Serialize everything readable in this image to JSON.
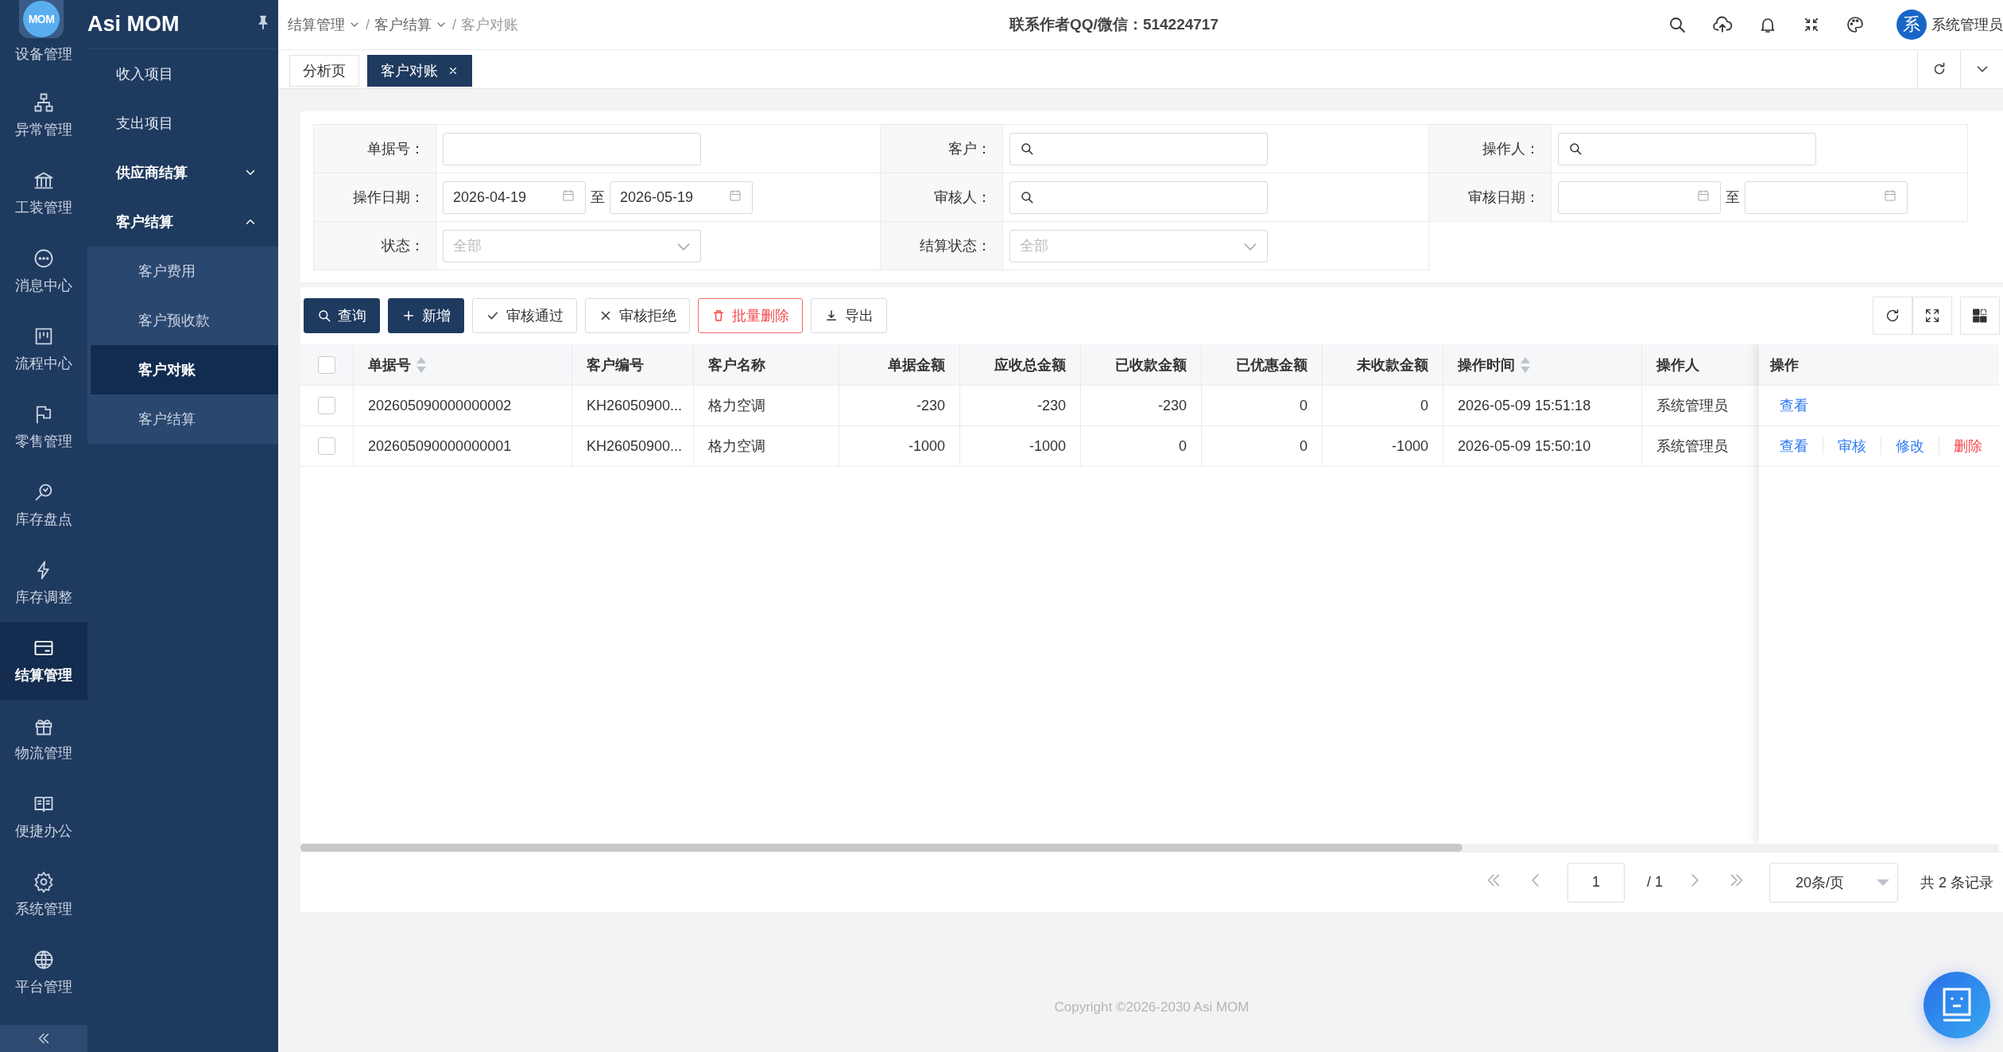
{
  "brand": {
    "logo": "MOM",
    "title": "Asi MOM"
  },
  "rail": [
    {
      "label": "设备管理",
      "selected": false
    },
    {
      "label": "异常管理",
      "selected": false
    },
    {
      "label": "工装管理",
      "selected": false
    },
    {
      "label": "消息中心",
      "selected": false
    },
    {
      "label": "流程中心",
      "selected": false
    },
    {
      "label": "零售管理",
      "selected": false
    },
    {
      "label": "库存盘点",
      "selected": false
    },
    {
      "label": "库存调整",
      "selected": false
    },
    {
      "label": "结算管理",
      "selected": true
    },
    {
      "label": "物流管理",
      "selected": false
    },
    {
      "label": "便捷办公",
      "selected": false
    },
    {
      "label": "系统管理",
      "selected": false
    },
    {
      "label": "平台管理",
      "selected": false
    }
  ],
  "submenu": [
    {
      "label": "收入项目",
      "selected": false
    },
    {
      "label": "支出项目",
      "selected": false
    },
    {
      "label": "供应商结算",
      "expanded": false
    },
    {
      "label": "客户结算",
      "expanded": true,
      "children": [
        {
          "label": "客户费用",
          "selected": false
        },
        {
          "label": "客户预收款",
          "selected": false
        },
        {
          "label": "客户对账",
          "selected": true
        },
        {
          "label": "客户结算",
          "selected": false
        }
      ]
    }
  ],
  "breadcrumb": [
    {
      "label": "结算管理",
      "dropdown": true,
      "separator": "/"
    },
    {
      "label": "客户结算",
      "dropdown": true,
      "separator": "/"
    },
    {
      "label": "客户对账",
      "dropdown": false
    }
  ],
  "contact": "联系作者QQ/微信：514224717",
  "user": {
    "avatar": "系",
    "name": "系统管理员"
  },
  "tabs": [
    {
      "label": "分析页",
      "selected": false,
      "closable": false
    },
    {
      "label": "客户对账",
      "selected": true,
      "closable": true
    }
  ],
  "filters": [
    {
      "label": "单据号：",
      "kind": "text"
    },
    {
      "label": "客户：",
      "kind": "search"
    },
    {
      "label": "操作人：",
      "kind": "search"
    },
    {
      "label": "操作日期：",
      "kind": "daterange",
      "from": "2026-04-19",
      "separator": "至",
      "to": "2026-05-19"
    },
    {
      "label": "审核人：",
      "kind": "search"
    },
    {
      "label": "审核日期：",
      "kind": "daterange",
      "separator": "至"
    },
    {
      "label": "状态：",
      "kind": "select",
      "placeholder": "全部"
    },
    {
      "label": "结算状态：",
      "kind": "select",
      "placeholder": "全部"
    }
  ],
  "actions": [
    {
      "label": "查询",
      "kind": "search"
    },
    {
      "label": "新增",
      "kind": "add"
    },
    {
      "label": "审核通过",
      "kind": "approve"
    },
    {
      "label": "审核拒绝",
      "kind": "reject"
    },
    {
      "label": "批量删除",
      "kind": "delete"
    },
    {
      "label": "导出",
      "kind": "export"
    }
  ],
  "table": {
    "select_all": {
      "checked": false
    },
    "columns": [
      {
        "label": "单据号",
        "sortable": true
      },
      {
        "label": "客户编号",
        "sortable": false
      },
      {
        "label": "客户名称",
        "sortable": false
      },
      {
        "label": "单据金额",
        "sortable": false
      },
      {
        "label": "应收总金额",
        "sortable": false
      },
      {
        "label": "已收款金额",
        "sortable": false
      },
      {
        "label": "已优惠金额",
        "sortable": false
      },
      {
        "label": "未收款金额",
        "sortable": false
      },
      {
        "label": "操作时间",
        "sortable": true
      },
      {
        "label": "操作人",
        "sortable": false
      }
    ],
    "actions_column": "操作",
    "rows": [
      {
        "checked": false,
        "cells": [
          "202605090000000002",
          "KH26050900...",
          "格力空调",
          "-230",
          "-230",
          "-230",
          "0",
          "0",
          "2026-05-09 15:51:18",
          "系统管理员"
        ],
        "actions": [
          {
            "label": "查看",
            "kind": "link"
          }
        ]
      },
      {
        "checked": false,
        "cells": [
          "202605090000000001",
          "KH26050900...",
          "格力空调",
          "-1000",
          "-1000",
          "0",
          "0",
          "-1000",
          "2026-05-09 15:50:10",
          "系统管理员"
        ],
        "actions": [
          {
            "label": "查看",
            "kind": "link"
          },
          {
            "label": "审核",
            "kind": "link"
          },
          {
            "label": "修改",
            "kind": "link"
          },
          {
            "label": "删除",
            "kind": "danger"
          }
        ]
      }
    ]
  },
  "pagination": {
    "page": "1",
    "total_pages": "/ 1",
    "page_size": "20条/页",
    "total": "共 2 条记录"
  },
  "copyright": "Copyright ©2026-2030 Asi MOM"
}
